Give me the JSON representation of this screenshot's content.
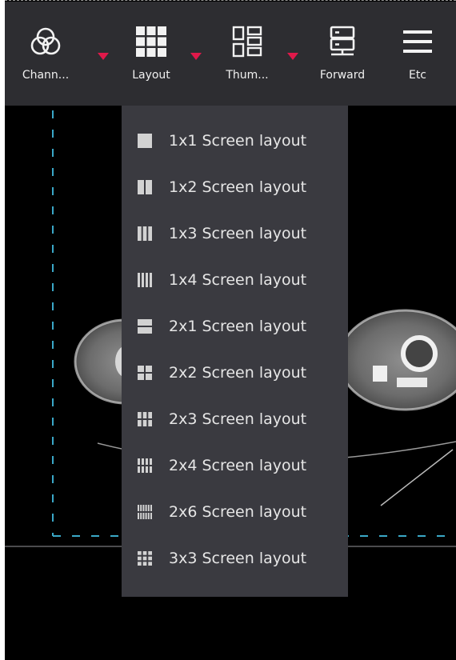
{
  "toolbar": {
    "items": [
      {
        "label": "Chann...",
        "icon": "channel-icon",
        "has_dropdown": true
      },
      {
        "label": "Layout",
        "icon": "grid-layout-icon",
        "has_dropdown": true
      },
      {
        "label": "Thum...",
        "icon": "thumbnail-icon",
        "has_dropdown": true
      },
      {
        "label": "Forward",
        "icon": "forward-server-icon",
        "has_dropdown": false
      },
      {
        "label": "Etc",
        "icon": "menu-hamburger-icon",
        "has_dropdown": false
      }
    ],
    "dropdown_caret_color": "#e0194a"
  },
  "layout_menu": {
    "items": [
      {
        "label": "1x1 Screen layout",
        "icon": "layout-1x1-icon"
      },
      {
        "label": "1x2 Screen layout",
        "icon": "layout-1x2-icon"
      },
      {
        "label": "1x3 Screen layout",
        "icon": "layout-1x3-icon"
      },
      {
        "label": "1x4 Screen layout",
        "icon": "layout-1x4-icon"
      },
      {
        "label": "2x1 Screen layout",
        "icon": "layout-2x1-icon"
      },
      {
        "label": "2x2 Screen layout",
        "icon": "layout-2x2-icon"
      },
      {
        "label": "2x3 Screen layout",
        "icon": "layout-2x3-icon"
      },
      {
        "label": "2x4 Screen layout",
        "icon": "layout-2x4-icon"
      },
      {
        "label": "2x6 Screen layout",
        "icon": "layout-2x6-icon"
      },
      {
        "label": "3x3 Screen layout",
        "icon": "layout-3x3-icon"
      }
    ]
  },
  "viewport": {
    "content": "CT axial slice image",
    "active_frame_color": "#3aa8c8"
  }
}
